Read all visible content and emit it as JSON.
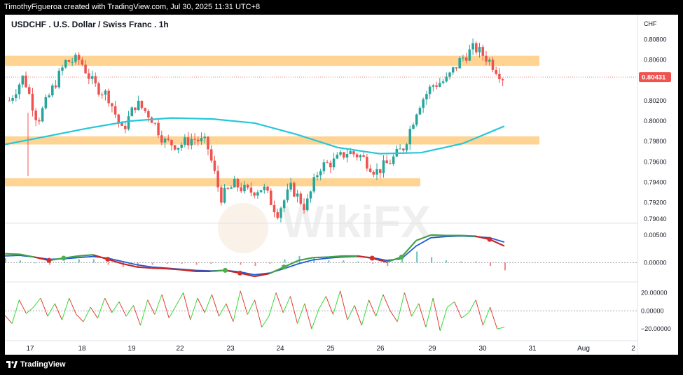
{
  "header": {
    "credit": "TimothyFigueroa created with TradingView.com, Jul 30, 2025 11:31 UTC+8"
  },
  "footer": {
    "logo_text": "TradingView"
  },
  "watermark": "WikiFX",
  "colors": {
    "up": "#26a69a",
    "down": "#ef5350",
    "zone": "#ffcc80",
    "ma": "#26c6da",
    "macd_signal_red": "#c62828",
    "macd_line_green": "#43a047",
    "macd_line_blue": "#1e5bd6",
    "osc_up": "#33dd33",
    "osc_down": "#e53935",
    "price_tag": "#ef5350",
    "dot_red": "#d32f2f",
    "dot_green": "#4caf50"
  },
  "chart_data": [
    {
      "type": "candlestick",
      "title": "USDCHF . U.S. Dollar / Swiss Franc . 1h",
      "currency_label": "CHF",
      "last_price": "0.80431",
      "y_ticks": [
        "0.80800",
        "0.80600",
        "0.80200",
        "0.80000",
        "0.79800",
        "0.79600",
        "0.79400",
        "0.79200",
        "0.79040"
      ],
      "ylim": [
        0.7904,
        0.8085
      ],
      "x_ticks": [
        "17",
        "18",
        "19",
        "22",
        "23",
        "24",
        "25",
        "26",
        "29",
        "30",
        "31",
        "Aug",
        "2"
      ],
      "grid": false,
      "zones": [
        {
          "from": 0.8054,
          "to": 0.8064,
          "until": "31"
        },
        {
          "from": 0.7977,
          "to": 0.7985,
          "until": "31"
        },
        {
          "from": 0.7936,
          "to": 0.7944,
          "until": "26"
        }
      ],
      "moving_average": [
        0.7977,
        0.7985,
        0.7993,
        0.8,
        0.8003,
        0.8002,
        0.7998,
        0.7987,
        0.7974,
        0.7968,
        0.7969,
        0.7978,
        0.7995
      ],
      "close_path": [
        0.802,
        0.8044,
        0.8,
        0.803,
        0.8058,
        0.806,
        0.8035,
        0.8025,
        0.799,
        0.8018,
        0.8005,
        0.798,
        0.7976,
        0.7983,
        0.7978,
        0.7925,
        0.7938,
        0.793,
        0.7935,
        0.791,
        0.7935,
        0.7915,
        0.7955,
        0.796,
        0.797,
        0.7965,
        0.795,
        0.796,
        0.7975,
        0.8015,
        0.8035,
        0.804,
        0.806,
        0.8072,
        0.806,
        0.8043
      ]
    },
    {
      "type": "line",
      "name_hint": "macd",
      "y_ticks": [
        "0.00500",
        "0.00000"
      ],
      "ylim": [
        -0.003,
        0.0065
      ],
      "series": [
        {
          "values": [
            0.0016,
            0.0015,
            0.001,
            0.0004,
            0.0008,
            0.0012,
            0.0014,
            0.0006,
            -0.0002,
            -0.0008,
            -0.001,
            -0.0011,
            -0.0013,
            -0.0016,
            -0.0016,
            -0.0014,
            -0.0019,
            -0.0025,
            -0.002,
            -0.0008,
            0.0004,
            0.0009,
            0.001,
            0.0012,
            0.0012,
            0.0008,
            0.0001,
            0.001,
            0.004,
            0.005,
            0.0049,
            0.0049,
            0.0048,
            0.0042,
            0.003
          ]
        },
        {
          "values": [
            0.0012,
            0.0013,
            0.001,
            0.0006,
            0.0007,
            0.0009,
            0.0011,
            0.0008,
            0.0002,
            -0.0004,
            -0.0008,
            -0.001,
            -0.0012,
            -0.0014,
            -0.0015,
            -0.0014,
            -0.0017,
            -0.0022,
            -0.0019,
            -0.0011,
            -0.0002,
            0.0005,
            0.0008,
            0.001,
            0.0011,
            0.0009,
            0.0004,
            0.0007,
            0.003,
            0.0045,
            0.0047,
            0.0048,
            0.0047,
            0.0045,
            0.0037
          ]
        }
      ]
    },
    {
      "type": "line",
      "name_hint": "oscillator",
      "y_ticks": [
        "20.00000",
        "0.00000",
        "−20.00000"
      ],
      "ylim": [
        -26,
        28
      ],
      "series": [
        {
          "values": [
            -5,
            -14,
            12,
            -3,
            4,
            14,
            -6,
            8,
            -10,
            14,
            -4,
            -12,
            4,
            -8,
            14,
            -2,
            10,
            -6,
            6,
            -16,
            12,
            -4,
            18,
            -8,
            6,
            20,
            -10,
            14,
            -2,
            18,
            -6,
            8,
            -12,
            22,
            -4,
            12,
            -18,
            -6,
            20,
            -2,
            16,
            -14,
            8,
            -20,
            2,
            16,
            -4,
            22,
            -10,
            6,
            -16,
            12,
            -6,
            18,
            0,
            -12,
            20,
            -6,
            8,
            -18,
            14,
            -22,
            4,
            10,
            -8,
            -2,
            12,
            -16,
            4,
            -20,
            -18
          ]
        }
      ]
    }
  ]
}
